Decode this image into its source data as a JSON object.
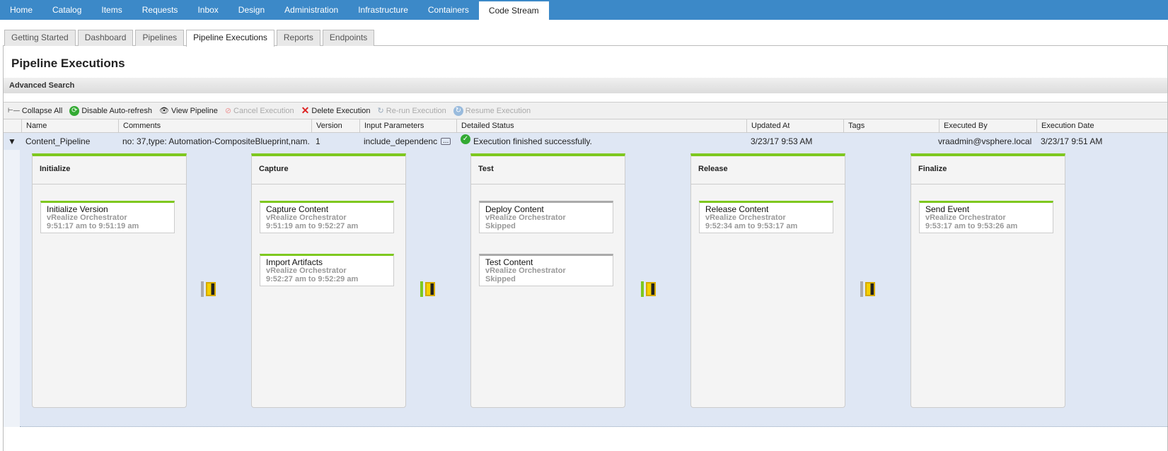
{
  "topnav": [
    "Home",
    "Catalog",
    "Items",
    "Requests",
    "Inbox",
    "Design",
    "Administration",
    "Infrastructure",
    "Containers",
    "Code Stream"
  ],
  "subtabs": [
    "Getting Started",
    "Dashboard",
    "Pipelines",
    "Pipeline Executions",
    "Reports",
    "Endpoints"
  ],
  "title": "Pipeline Executions",
  "advanced_search": "Advanced Search",
  "toolbar": {
    "collapse": "Collapse All",
    "autorefresh": "Disable Auto-refresh",
    "view": "View Pipeline",
    "cancel": "Cancel Execution",
    "delete": "Delete Execution",
    "rerun": "Re-run Execution",
    "resume": "Resume Execution"
  },
  "columns": [
    "Name",
    "Comments",
    "Version",
    "Input Parameters",
    "Detailed Status",
    "Updated At",
    "Tags",
    "Executed By",
    "Execution Date"
  ],
  "row": {
    "name": "Content_Pipeline",
    "comments": "no: 37,type: Automation-CompositeBlueprint,nam...",
    "version": "1",
    "input": "include_dependenc",
    "status": "Execution finished successfully.",
    "updated": "3/23/17 9:53 AM",
    "tags": "",
    "executed_by": "vraadmin@vsphere.local",
    "date": "3/23/17 9:51 AM",
    "ellipsis": "..."
  },
  "stages": [
    {
      "name": "Initialize",
      "tasks": [
        {
          "name": "Initialize Version",
          "provider": "vRealize Orchestrator",
          "time": "9:51:17 am to 9:51:19 am",
          "state": "success"
        }
      ]
    },
    {
      "name": "Capture",
      "tasks": [
        {
          "name": "Capture Content",
          "provider": "vRealize Orchestrator",
          "time": "9:51:19 am to 9:52:27 am",
          "state": "success"
        },
        {
          "name": "Import Artifacts",
          "provider": "vRealize Orchestrator",
          "time": "9:52:27 am to 9:52:29 am",
          "state": "success"
        }
      ]
    },
    {
      "name": "Test",
      "tasks": [
        {
          "name": "Deploy Content",
          "provider": "vRealize Orchestrator",
          "time": "Skipped",
          "state": "skipped"
        },
        {
          "name": "Test Content",
          "provider": "vRealize Orchestrator",
          "time": "Skipped",
          "state": "skipped"
        }
      ]
    },
    {
      "name": "Release",
      "tasks": [
        {
          "name": "Release Content",
          "provider": "vRealize Orchestrator",
          "time": "9:52:34 am to 9:53:17 am",
          "state": "success"
        }
      ]
    },
    {
      "name": "Finalize",
      "tasks": [
        {
          "name": "Send Event",
          "provider": "vRealize Orchestrator",
          "time": "9:53:17 am to 9:53:26 am",
          "state": "success"
        }
      ]
    }
  ],
  "gates": [
    "gray",
    "green",
    "green",
    "gray"
  ],
  "colors": {
    "nav": "#3c89c8",
    "success": "#7ec81f",
    "skipped": "#aaaaaa",
    "stage_bg": "#dfe7f4"
  }
}
